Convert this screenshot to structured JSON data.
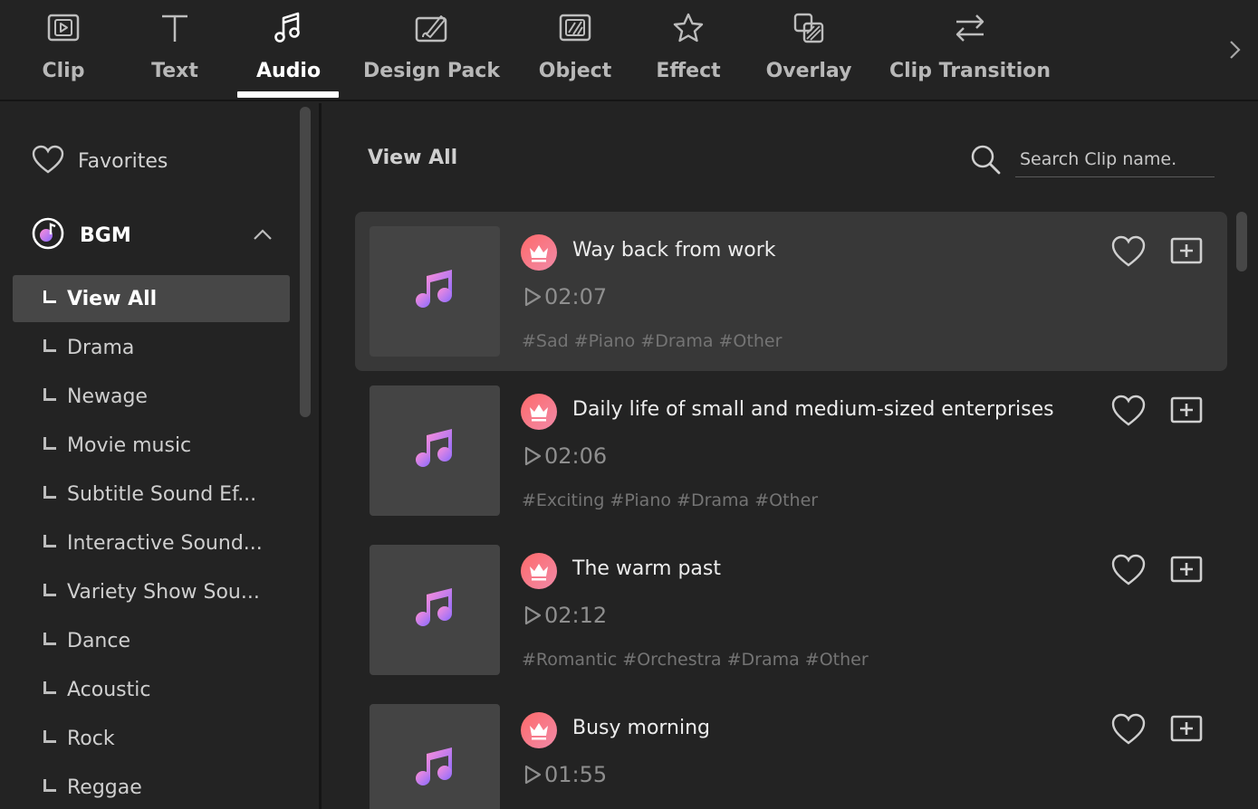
{
  "toolbar": {
    "tabs": [
      {
        "label": "Clip",
        "icon": "clip-icon"
      },
      {
        "label": "Text",
        "icon": "text-icon"
      },
      {
        "label": "Audio",
        "icon": "music-note-icon",
        "active": true
      },
      {
        "label": "Design Pack",
        "icon": "design-pack-icon"
      },
      {
        "label": "Object",
        "icon": "object-icon"
      },
      {
        "label": "Effect",
        "icon": "effect-star-icon"
      },
      {
        "label": "Overlay",
        "icon": "overlay-icon"
      },
      {
        "label": "Clip Transition",
        "icon": "transition-arrows-icon"
      }
    ],
    "more_icon": "chevron-right-icon"
  },
  "sidebar": {
    "favorites_label": "Favorites",
    "section_label": "BGM",
    "categories": [
      {
        "label": "View All",
        "active": true
      },
      {
        "label": "Drama"
      },
      {
        "label": "Newage"
      },
      {
        "label": "Movie music"
      },
      {
        "label": "Subtitle Sound Ef..."
      },
      {
        "label": "Interactive Sound..."
      },
      {
        "label": "Variety Show Sou..."
      },
      {
        "label": "Dance"
      },
      {
        "label": "Acoustic"
      },
      {
        "label": "Rock"
      },
      {
        "label": "Reggae"
      }
    ]
  },
  "main": {
    "title": "View All",
    "search": {
      "placeholder": "Search Clip name.",
      "value": ""
    },
    "items": [
      {
        "title": "Way back from work",
        "duration": "02:07",
        "tags": "#Sad #Piano #Drama #Other"
      },
      {
        "title": "Daily life of small and medium-sized enterprises",
        "duration": "02:06",
        "tags": "#Exciting #Piano #Drama #Other"
      },
      {
        "title": "The warm past",
        "duration": "02:12",
        "tags": "#Romantic #Orchestra #Drama #Other"
      },
      {
        "title": "Busy morning",
        "duration": "01:55",
        "tags": ""
      }
    ]
  },
  "colors": {
    "background": "#232323",
    "active_item_bg": "#474747",
    "hover_card_bg": "#383838",
    "crown_badge_start": "#ff6a6a",
    "crown_badge_end": "#f08aa8",
    "music_icon_start": "#ff8fd8",
    "music_icon_end": "#8a6bff"
  }
}
